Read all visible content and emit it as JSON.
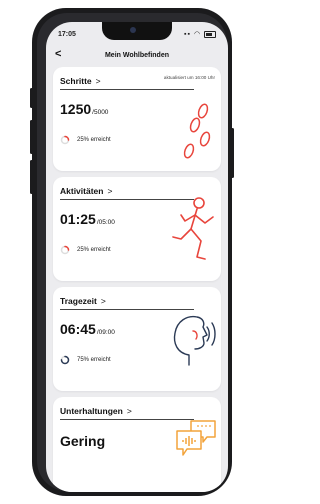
{
  "status_bar": {
    "time": "17:05"
  },
  "nav": {
    "back": "<",
    "title": "Mein Wohlbefinden"
  },
  "cards": {
    "steps": {
      "title": "Schritte",
      "chevron": ">",
      "updated": "aktualisiert um 16:00 Uhr",
      "value": "1250",
      "goal": "/5000",
      "progress_text": "25% erreicht",
      "progress": 0.25,
      "ring_color": "#e8453c"
    },
    "activity": {
      "title": "Aktivitäten",
      "chevron": ">",
      "value": "01:25",
      "goal": "/05:00",
      "progress_text": "25% erreicht",
      "progress": 0.25,
      "ring_color": "#e8453c"
    },
    "wear": {
      "title": "Tragezeit",
      "chevron": ">",
      "value": "06:45",
      "goal": "/09:00",
      "progress_text": "75% erreicht",
      "progress": 0.75,
      "ring_color": "#2b3a55"
    },
    "conversations": {
      "title": "Unterhaltungen",
      "chevron": ">",
      "value": "Gering"
    }
  },
  "colors": {
    "accent_red": "#e8453c",
    "accent_orange": "#f2a33a",
    "dark": "#2b3a55"
  }
}
